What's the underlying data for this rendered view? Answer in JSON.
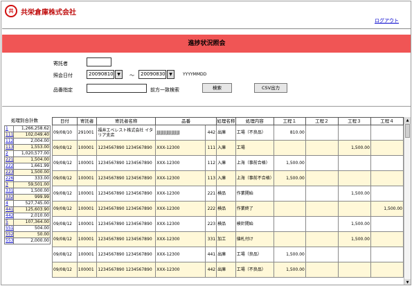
{
  "header": {
    "logo_mark": "共",
    "company": "共栄倉庫株式会社",
    "logout": "ログアウト"
  },
  "page_title": "進捗状況照会",
  "form": {
    "consignor_label": "寄託者",
    "consignor_value": "",
    "date_label": "照会日付",
    "date_from": "20090810",
    "date_sep": "～",
    "date_to": "20090830",
    "date_format": "YYYYMMDD",
    "item_label": "品番指定",
    "item_value": "",
    "prefix_label": "前方一致検索",
    "search_btn": "検索",
    "csv_btn": "CSV出力"
  },
  "summary": {
    "title": "処理別合計数",
    "rows": [
      {
        "code": "1",
        "value": "1,266,258.62",
        "y": false
      },
      {
        "code": "111",
        "value": "102,049.40",
        "y": true
      },
      {
        "code": "112",
        "value": "2,004.00",
        "y": false
      },
      {
        "code": "113",
        "value": "1,553.00",
        "y": true
      },
      {
        "code": "2",
        "value": "1,020,577.00",
        "y": false
      },
      {
        "code": "221",
        "value": "1,504.00",
        "y": true
      },
      {
        "code": "222",
        "value": "1,661.99",
        "y": false
      },
      {
        "code": "223",
        "value": "1,500.00",
        "y": true
      },
      {
        "code": "226",
        "value": "333.00",
        "y": false
      },
      {
        "code": "3",
        "value": "59,501.00",
        "y": true
      },
      {
        "code": "331",
        "value": "1,500.00",
        "y": false
      },
      {
        "code": "332",
        "value": "999.99",
        "y": true
      },
      {
        "code": "4",
        "value": "527,745.00",
        "y": false
      },
      {
        "code": "441",
        "value": "125,603.90",
        "y": true
      },
      {
        "code": "442",
        "value": "2,010.00",
        "y": false
      },
      {
        "code": "5",
        "value": "107,364.00",
        "y": true
      },
      {
        "code": "551",
        "value": "504.00",
        "y": false
      },
      {
        "code": "552",
        "value": "50.00",
        "y": true
      },
      {
        "code": "553",
        "value": "2,000.00",
        "y": false
      }
    ]
  },
  "table": {
    "headers": [
      "日付",
      "寄託者",
      "寄託者名称",
      "品番",
      "処理名称",
      "処理内容",
      "工程１",
      "工程２",
      "工程３",
      "工程４"
    ],
    "rows": [
      {
        "date": "09/08/10",
        "cons": "291001",
        "name": "福井エベレスト株式会社 イタリア支店",
        "item": "JJJJJJJJJJJJJJJJJJJ",
        "code": "442",
        "pname": "出庫",
        "pcontent": "工場（不良品）",
        "s1": "810.00",
        "s2": "",
        "s3": "",
        "s4": "",
        "y": false
      },
      {
        "date": "09/08/12",
        "cons": "100001",
        "name": "1234567890 1234567890",
        "item": "XXX-12300",
        "code": "111",
        "pname": "入庫",
        "pcontent": "工場",
        "s1": "",
        "s2": "",
        "s3": "1,500.00",
        "s4": "",
        "y": true
      },
      {
        "date": "09/08/12",
        "cons": "100001",
        "name": "1234567890 1234567890",
        "item": "XXX-12300",
        "code": "112",
        "pname": "入庫",
        "pcontent": "上海（事前合格）",
        "s1": "1,500.00",
        "s2": "",
        "s3": "",
        "s4": "",
        "y": false
      },
      {
        "date": "09/08/12",
        "cons": "100001",
        "name": "1234567890 1234567890",
        "item": "XXX-12300",
        "code": "113",
        "pname": "入庫",
        "pcontent": "上海（事前不合格）",
        "s1": "1,500.00",
        "s2": "",
        "s3": "",
        "s4": "",
        "y": true
      },
      {
        "date": "09/08/12",
        "cons": "100001",
        "name": "1234567890 1234567890",
        "item": "XXX-12300",
        "code": "221",
        "pname": "検品",
        "pcontent": "作業開始",
        "s1": "",
        "s2": "",
        "s3": "1,500.00",
        "s4": "",
        "y": false
      },
      {
        "date": "09/08/12",
        "cons": "100001",
        "name": "1234567890 1234567890",
        "item": "XXX-12300",
        "code": "222",
        "pname": "検品",
        "pcontent": "作業終了",
        "s1": "",
        "s2": "",
        "s3": "",
        "s4": "1,500.00",
        "y": true
      },
      {
        "date": "09/08/12",
        "cons": "100001",
        "name": "1234567890 1234567890",
        "item": "XXX-12300",
        "code": "223",
        "pname": "検品",
        "pcontent": "検針開始",
        "s1": "",
        "s2": "",
        "s3": "1,500.00",
        "s4": "",
        "y": false
      },
      {
        "date": "09/08/12",
        "cons": "100001",
        "name": "1234567890 1234567890",
        "item": "XXX-12300",
        "code": "331",
        "pname": "加工",
        "pcontent": "値札付け",
        "s1": "",
        "s2": "",
        "s3": "1,500.00",
        "s4": "",
        "y": true
      },
      {
        "date": "09/08/12",
        "cons": "100001",
        "name": "1234567890 1234567890",
        "item": "XXX-12300",
        "code": "441",
        "pname": "出庫",
        "pcontent": "工場（良品）",
        "s1": "1,500.00",
        "s2": "",
        "s3": "",
        "s4": "",
        "y": false
      },
      {
        "date": "09/08/12",
        "cons": "100001",
        "name": "1234567890 1234567890",
        "item": "XXX-12300",
        "code": "442",
        "pname": "出庫",
        "pcontent": "工場（不良品）",
        "s1": "1,500.00",
        "s2": "",
        "s3": "",
        "s4": "",
        "y": true
      }
    ]
  }
}
